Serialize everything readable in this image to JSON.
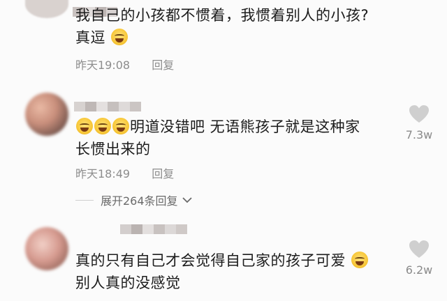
{
  "comments": [
    {
      "text_line1": "我自己的小孩都不惯着，我惯着别人的小孩?",
      "text_line2": "真逗",
      "time": "昨天19:08",
      "reply_label": "回复"
    },
    {
      "text_line1": "明道没错吧 无语熊孩子就是这种家",
      "text_line2": "长惯出来的",
      "time": "昨天18:49",
      "reply_label": "回复",
      "likes": "7.3w",
      "expand_label": "展开264条回复"
    },
    {
      "text_line1": "真的只有自己才会觉得自己家的孩子可爱",
      "text_line2": "别人真的没感觉",
      "likes": "6.2w"
    }
  ],
  "icons": {
    "emoji": "laughing-crying-emoji-icon",
    "like": "heart-icon",
    "chevron": "chevron-down-icon"
  },
  "colors": {
    "background": "#fbfbfb",
    "text": "#1c1c1c",
    "meta": "#8d8d8d",
    "heart": "#cfcfcf"
  }
}
